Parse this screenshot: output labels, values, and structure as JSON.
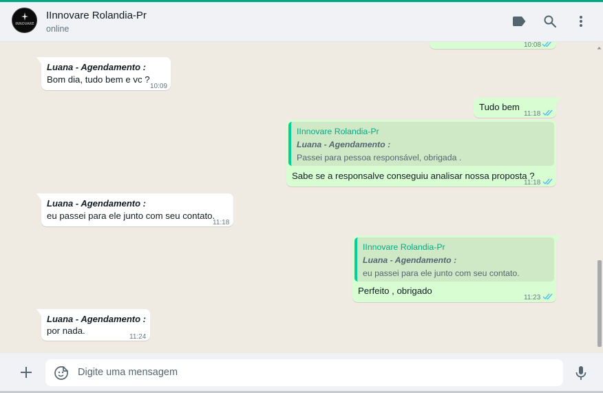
{
  "header": {
    "contact_name": "IInnovare Rolandia-Pr",
    "status": "online",
    "avatar_brand": "INNOVARE",
    "icons": [
      "label-icon",
      "search-icon",
      "menu-dots-icon"
    ]
  },
  "messages": [
    {
      "direction": "out",
      "time": "10:08",
      "read": true,
      "partial": true
    },
    {
      "direction": "in",
      "sender": "Luana - Agendamento :",
      "text": "Bom dia, tudo bem e vc ?",
      "time": "10:09"
    },
    {
      "direction": "out",
      "text": "Tudo bem",
      "time": "11:18",
      "read": true
    },
    {
      "direction": "out",
      "quote": {
        "author": "IInnovare Rolandia-Pr",
        "sender": "Luana - Agendamento :",
        "text": "Passei para pessoa responsável, obrigada ."
      },
      "text": "Sabe se a responsalve conseguiu analisar nossa proposta ?",
      "time": "11:18",
      "read": true
    },
    {
      "direction": "in",
      "sender": "Luana - Agendamento :",
      "text": "eu passei para ele junto com seu contato.",
      "time": "11:18"
    },
    {
      "direction": "out",
      "quote": {
        "author": "IInnovare Rolandia-Pr",
        "sender": "Luana - Agendamento :",
        "text": "eu passei para ele junto com seu contato."
      },
      "text": "Perfeito , obrigado",
      "time": "11:23",
      "read": true
    },
    {
      "direction": "in",
      "sender": "Luana - Agendamento :",
      "text": "por nada.",
      "time": "11:24"
    }
  ],
  "composer": {
    "placeholder": "Digite uma mensagem",
    "icons": [
      "plus-icon",
      "emoji-icon",
      "mic-icon"
    ]
  },
  "colors": {
    "accent": "#00a884",
    "outgoing_bubble": "#d9fdd3",
    "incoming_bubble": "#ffffff",
    "chat_background": "#efeae2",
    "read_ticks": "#53bdeb",
    "quote_author": "#06cf9c"
  }
}
